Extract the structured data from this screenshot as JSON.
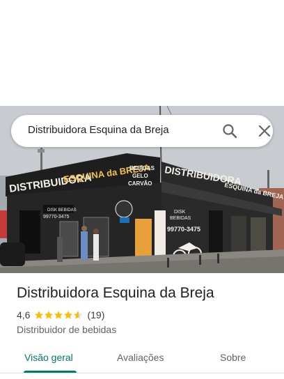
{
  "search": {
    "query": "Distribuidora Esquina da Breja"
  },
  "storefront": {
    "sign_main": "DISTRIBUIDORA ESQUINA da BREJA",
    "sign_side": "DISTRIBUIDORA ESQUINA da BREJA",
    "sign_products": "BEBIDAS GELO CARVÃO",
    "door_sign": "DISK BEBIDAS",
    "phone": "99770-3475",
    "colors": {
      "facade": "#1e1e1e",
      "sign_text": "#f4f1ea",
      "accent": "#f2c14e",
      "door": "#e8a13a"
    }
  },
  "place": {
    "name": "Distribuidora Esquina da Breja",
    "rating": "4,6",
    "stars_filled": 4.6,
    "reviews": "(19)",
    "category": "Distribuidor de bebidas",
    "star_color": "#fbbc04"
  },
  "tabs": [
    {
      "label": "Visão geral",
      "active": true
    },
    {
      "label": "Avaliações",
      "active": false
    },
    {
      "label": "Sobre",
      "active": false
    }
  ],
  "accent_color": "#00796b"
}
